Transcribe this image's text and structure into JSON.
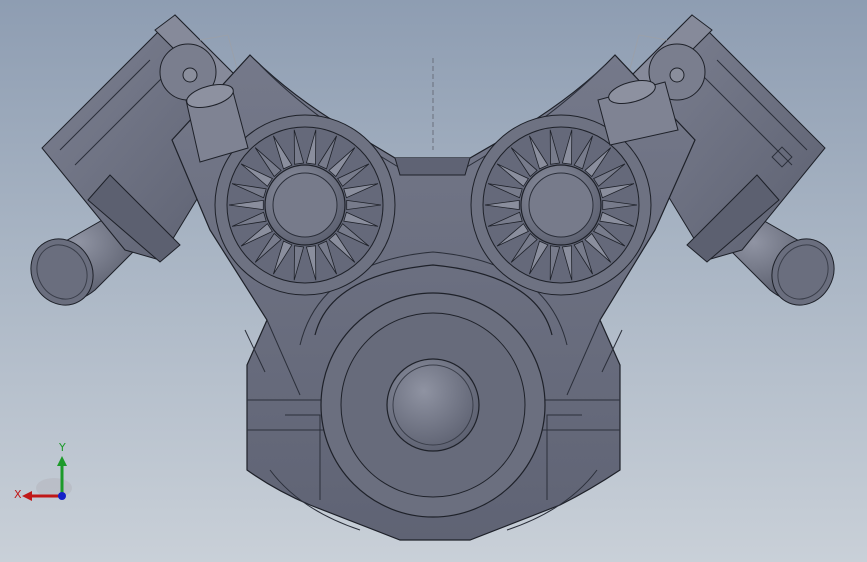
{
  "viewport": {
    "background_top": "#8e9db2",
    "background_bottom": "#c9d0d8"
  },
  "model": {
    "body_color": "#6d7181",
    "edge_color": "#1e2129",
    "highlight_color": "#9a9eab",
    "shadow_color": "#4e5260"
  },
  "triad": {
    "x_label": "X",
    "y_label": "Y",
    "x_color": "#c01818",
    "y_color": "#1c9a2a",
    "z_color": "#1420c8"
  }
}
